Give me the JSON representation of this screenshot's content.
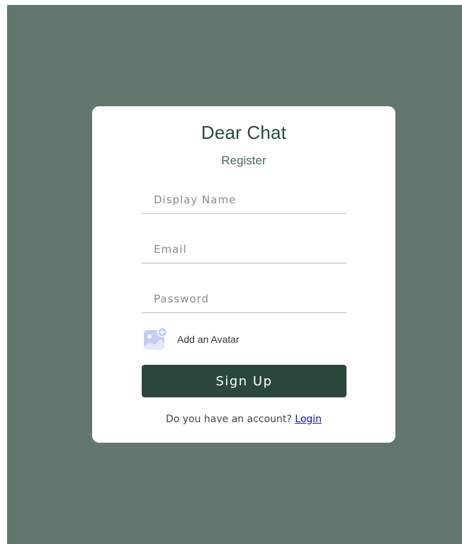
{
  "app": {
    "logo": "Dear Chat",
    "subtitle": "Register"
  },
  "form": {
    "display_name_placeholder": "Display Name",
    "email_placeholder": "Email",
    "password_placeholder": "Password",
    "avatar_label": "Add an Avatar",
    "avatar_icon": "add-image-icon",
    "submit_label": "Sign Up"
  },
  "footer": {
    "prompt": "Do you have an account? ",
    "login_link": "Login"
  },
  "colors": {
    "background": "#61776b",
    "card": "#ffffff",
    "primary": "#2a473a",
    "input_underline": "#a9c4bb",
    "avatar_icon": "#c4ccf7"
  }
}
